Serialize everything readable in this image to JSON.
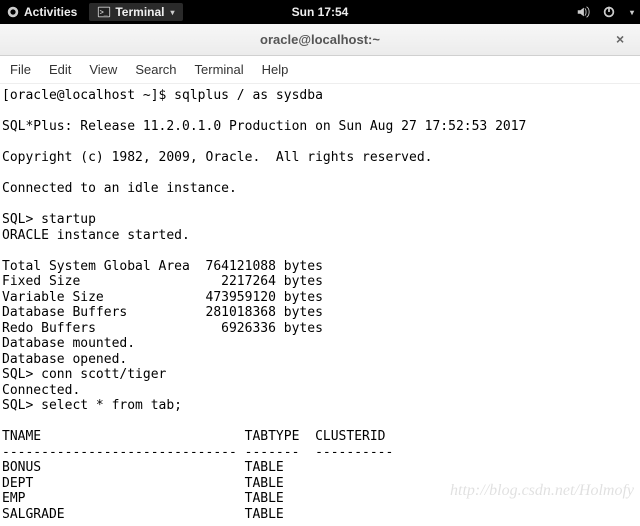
{
  "topbar": {
    "activities_label": "Activities",
    "task_label": "Terminal",
    "clock": "Sun 17:54"
  },
  "window": {
    "title": "oracle@localhost:~",
    "close_glyph": "×"
  },
  "menubar": {
    "file": "File",
    "edit": "Edit",
    "view": "View",
    "search": "Search",
    "terminal": "Terminal",
    "help": "Help"
  },
  "terminal_lines": [
    "[oracle@localhost ~]$ sqlplus / as sysdba",
    "",
    "SQL*Plus: Release 11.2.0.1.0 Production on Sun Aug 27 17:52:53 2017",
    "",
    "Copyright (c) 1982, 2009, Oracle.  All rights reserved.",
    "",
    "Connected to an idle instance.",
    "",
    "SQL> startup",
    "ORACLE instance started.",
    "",
    "Total System Global Area  764121088 bytes",
    "Fixed Size                  2217264 bytes",
    "Variable Size             473959120 bytes",
    "Database Buffers          281018368 bytes",
    "Redo Buffers                6926336 bytes",
    "Database mounted.",
    "Database opened.",
    "SQL> conn scott/tiger",
    "Connected.",
    "SQL> select * from tab;",
    "",
    "TNAME                          TABTYPE  CLUSTERID",
    "------------------------------ -------  ----------",
    "BONUS                          TABLE",
    "DEPT                           TABLE",
    "EMP                            TABLE",
    "SALGRADE                       TABLE"
  ],
  "watermark": "http://blog.csdn.net/Holmofy"
}
